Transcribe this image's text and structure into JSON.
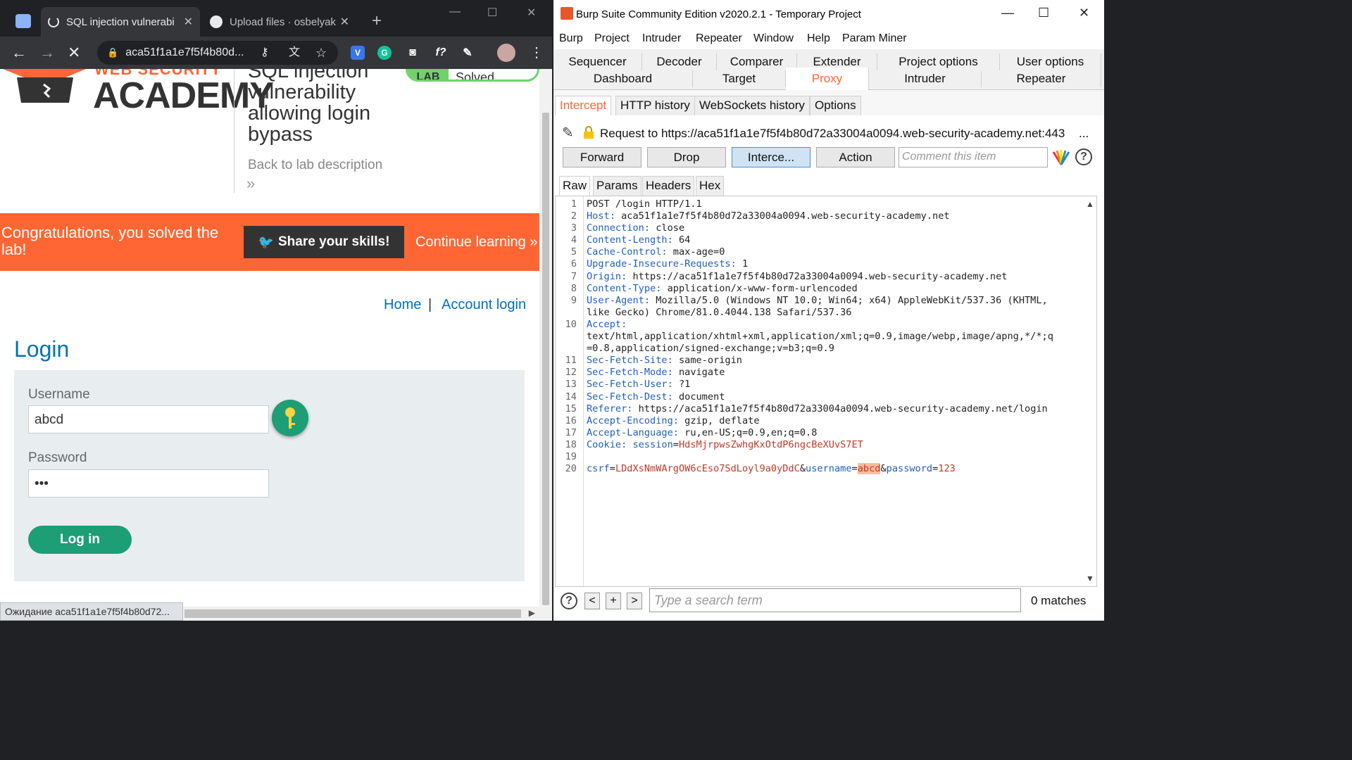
{
  "chrome": {
    "tabs": [
      {
        "title": "SQL injection vulnerabi",
        "icon": "loading-spinner-icon"
      },
      {
        "title": "Upload files · osbelyak",
        "icon": "github-icon"
      }
    ],
    "close_glyph": "✕",
    "new_tab": "+",
    "url": "aca51f1a1e7f5f4b80d...",
    "status": "Ожидание aca51f1a1e7f5f4b80d72..."
  },
  "page": {
    "logo_top": "WEB SECURITY",
    "logo_word": "ACADEMY",
    "lab_title": "SQL injection vulnerability allowing login bypass",
    "lab_badge": "LAB",
    "lab_status": "Solved",
    "back_link": "Back to lab description",
    "back_arrows": "»",
    "banner_text": "Congratulations, you solved the lab!",
    "share_button": "Share your skills!",
    "continue_link": "Continue learning",
    "continue_arrows": "»",
    "nav_home": "Home",
    "nav_sep": "|",
    "nav_account": "Account login",
    "login_heading": "Login",
    "username_label": "Username",
    "username_value": "abcd",
    "password_label": "Password",
    "password_value": "•••",
    "login_button": "Log in"
  },
  "burp": {
    "title": "Burp Suite Community Edition v2020.2.1 - Temporary Project",
    "menu": [
      "Burp",
      "Project",
      "Intruder",
      "Repeater",
      "Window",
      "Help",
      "Param Miner"
    ],
    "tabs_row1": [
      "Sequencer",
      "Decoder",
      "Comparer",
      "Extender",
      "Project options",
      "User options"
    ],
    "tabs_row2": [
      "Dashboard",
      "Target",
      "Proxy",
      "Intruder",
      "Repeater"
    ],
    "proxy_tabs": [
      "Intercept",
      "HTTP history",
      "WebSockets history",
      "Options"
    ],
    "request_to": "Request to https://aca51f1a1e7f5f4b80d72a33004a0094.web-security-academy.net:443",
    "ellipsis": "...",
    "buttons": {
      "forward": "Forward",
      "drop": "Drop",
      "intercept": "Interce...",
      "action": "Action"
    },
    "comment_placeholder": "Comment this item",
    "view_tabs": [
      "Raw",
      "Params",
      "Headers",
      "Hex"
    ],
    "search_placeholder": "Type a search term",
    "search_buttons": [
      "<",
      "+",
      ">"
    ],
    "help_glyph": "?",
    "matches": "0 matches",
    "request_lines": [
      {
        "n": "1",
        "parts": [
          {
            "t": "POST /login HTTP/1.1"
          }
        ]
      },
      {
        "n": "2",
        "parts": [
          {
            "t": "Host:",
            "c": "k"
          },
          {
            "t": " aca51f1a1e7f5f4b80d72a33004a0094.web-security-academy.net"
          }
        ]
      },
      {
        "n": "3",
        "parts": [
          {
            "t": "Connection:",
            "c": "k"
          },
          {
            "t": " close"
          }
        ]
      },
      {
        "n": "4",
        "parts": [
          {
            "t": "Content-Length:",
            "c": "k"
          },
          {
            "t": " 64"
          }
        ]
      },
      {
        "n": "5",
        "parts": [
          {
            "t": "Cache-Control:",
            "c": "k"
          },
          {
            "t": " max-age=0"
          }
        ]
      },
      {
        "n": "6",
        "parts": [
          {
            "t": "Upgrade-Insecure-Requests:",
            "c": "k"
          },
          {
            "t": " 1"
          }
        ]
      },
      {
        "n": "7",
        "parts": [
          {
            "t": "Origin:",
            "c": "k"
          },
          {
            "t": " https://aca51f1a1e7f5f4b80d72a33004a0094.web-security-academy.net"
          }
        ]
      },
      {
        "n": "8",
        "parts": [
          {
            "t": "Content-Type:",
            "c": "k"
          },
          {
            "t": " application/x-www-form-urlencoded"
          }
        ]
      },
      {
        "n": "9",
        "parts": [
          {
            "t": "User-Agent:",
            "c": "k"
          },
          {
            "t": " Mozilla/5.0 (Windows NT 10.0; Win64; x64) AppleWebKit/537.36 (KHTML,"
          }
        ]
      },
      {
        "n": "",
        "parts": [
          {
            "t": "like Gecko) Chrome/81.0.4044.138 Safari/537.36"
          }
        ]
      },
      {
        "n": "10",
        "parts": [
          {
            "t": "Accept:",
            "c": "k"
          }
        ]
      },
      {
        "n": "",
        "parts": [
          {
            "t": "text/html,application/xhtml+xml,application/xml;q=0.9,image/webp,image/apng,*/*;q"
          }
        ]
      },
      {
        "n": "",
        "parts": [
          {
            "t": "=0.8,application/signed-exchange;v=b3;q=0.9"
          }
        ]
      },
      {
        "n": "11",
        "parts": [
          {
            "t": "Sec-Fetch-Site:",
            "c": "k"
          },
          {
            "t": " same-origin"
          }
        ]
      },
      {
        "n": "12",
        "parts": [
          {
            "t": "Sec-Fetch-Mode:",
            "c": "k"
          },
          {
            "t": " navigate"
          }
        ]
      },
      {
        "n": "13",
        "parts": [
          {
            "t": "Sec-Fetch-User:",
            "c": "k"
          },
          {
            "t": " ?1"
          }
        ]
      },
      {
        "n": "14",
        "parts": [
          {
            "t": "Sec-Fetch-Dest:",
            "c": "k"
          },
          {
            "t": " document"
          }
        ]
      },
      {
        "n": "15",
        "parts": [
          {
            "t": "Referer:",
            "c": "k"
          },
          {
            "t": " https://aca51f1a1e7f5f4b80d72a33004a0094.web-security-academy.net/login"
          }
        ]
      },
      {
        "n": "16",
        "parts": [
          {
            "t": "Accept-Encoding:",
            "c": "k"
          },
          {
            "t": " gzip, deflate"
          }
        ]
      },
      {
        "n": "17",
        "parts": [
          {
            "t": "Accept-Language:",
            "c": "k"
          },
          {
            "t": " ru,en-US;q=0.9,en;q=0.8"
          }
        ]
      },
      {
        "n": "18",
        "parts": [
          {
            "t": "Cookie:",
            "c": "k"
          },
          {
            "t": " "
          },
          {
            "t": "session",
            "c": "k"
          },
          {
            "t": "="
          },
          {
            "t": "HdsMjrpwsZwhgKxOtdP6ngcBeXUvS7ET",
            "c": "rv"
          }
        ]
      },
      {
        "n": "19",
        "parts": [
          {
            "t": ""
          }
        ]
      },
      {
        "n": "20",
        "parts": [
          {
            "t": "csrf",
            "c": "k"
          },
          {
            "t": "="
          },
          {
            "t": "LDdXsNmWArgOW6cEso7SdLoyl9a0yDdC",
            "c": "rv"
          },
          {
            "t": "&"
          },
          {
            "t": "username",
            "c": "k"
          },
          {
            "t": "="
          },
          {
            "t": "abcd",
            "c": "hl"
          },
          {
            "t": "&"
          },
          {
            "t": "password",
            "c": "k"
          },
          {
            "t": "="
          },
          {
            "t": "123",
            "c": "rv"
          }
        ]
      }
    ]
  },
  "colors": {
    "portswigger_orange": "#ff6633",
    "academy_green": "#1d9e74",
    "link_blue": "#0071bc",
    "burp_selected_tab": "#ff6633"
  }
}
